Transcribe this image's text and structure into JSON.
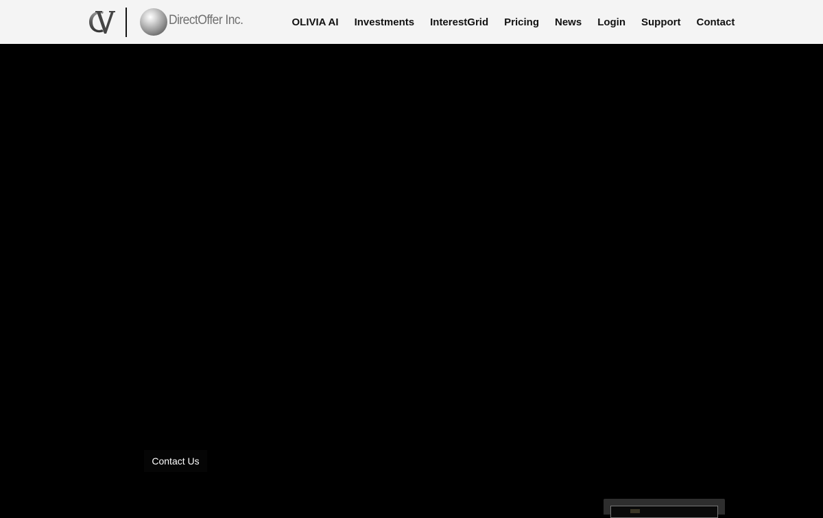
{
  "header": {
    "brand_name": "DirectOffer Inc.",
    "cv_logo_text": "CV",
    "nav": [
      {
        "label": "OLIVIA AI"
      },
      {
        "label": "Investments"
      },
      {
        "label": "InterestGrid"
      },
      {
        "label": "Pricing"
      },
      {
        "label": "News"
      },
      {
        "label": "Login"
      },
      {
        "label": "Support"
      },
      {
        "label": "Contact"
      }
    ]
  },
  "hero": {
    "contact_button_label": "Contact Us"
  },
  "colors": {
    "navbar_bg": "#f4f4f4",
    "page_bg": "#000000",
    "nav_text": "#111111",
    "logo_gray": "#6f6f6f"
  },
  "icons": {
    "cv_logo": "cv-monogram-logo",
    "directoffer_logo": "silver-sphere-logo"
  }
}
